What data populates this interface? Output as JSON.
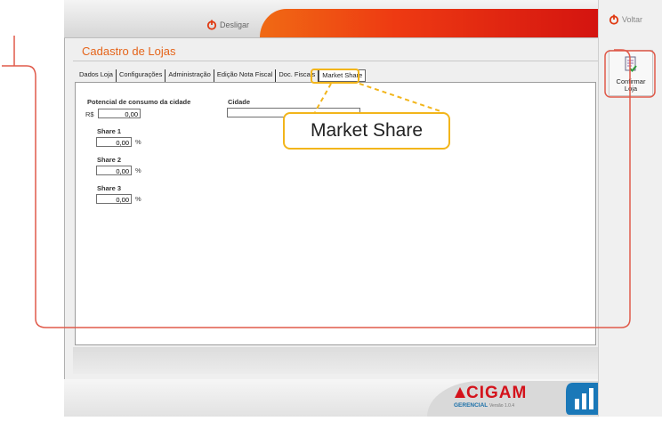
{
  "header": {
    "logoff_label": "Desligar",
    "back_label": "Voltar"
  },
  "toolbar": {
    "confirm_line1": "Confirmar",
    "confirm_line2": "Loja"
  },
  "form": {
    "title": "Cadastro de Lojas",
    "tabs": [
      {
        "label": "Dados Loja",
        "active": false
      },
      {
        "label": "Configurações",
        "active": false
      },
      {
        "label": "Administração",
        "active": false
      },
      {
        "label": "Edição Nota Fiscal",
        "active": false
      },
      {
        "label": "Doc. Fiscais",
        "active": false
      },
      {
        "label": "Market Share",
        "active": true
      }
    ],
    "potential": {
      "label": "Potencial de consumo da cidade",
      "currency": "R$",
      "value": "0,00"
    },
    "city": {
      "label": "Cidade",
      "value": ""
    },
    "shares": [
      {
        "label": "Share 1",
        "value": "0,00",
        "unit": "%"
      },
      {
        "label": "Share 2",
        "value": "0,00",
        "unit": "%"
      },
      {
        "label": "Share 3",
        "value": "0,00",
        "unit": "%"
      }
    ]
  },
  "callout": {
    "text": "Market Share"
  },
  "footer": {
    "brand": "CIGAM",
    "subtitle": "GERENCIAL",
    "version": "Versão 1.0.4"
  },
  "colors": {
    "accent_orange": "#e5641a",
    "highlight_yellow": "#f2b51b",
    "brand_red": "#d4121b",
    "annotation_red": "#e05a4a"
  },
  "icons": [
    "power-icon",
    "document-check-icon",
    "cigam-logo-icon",
    "bar-chart-icon"
  ]
}
